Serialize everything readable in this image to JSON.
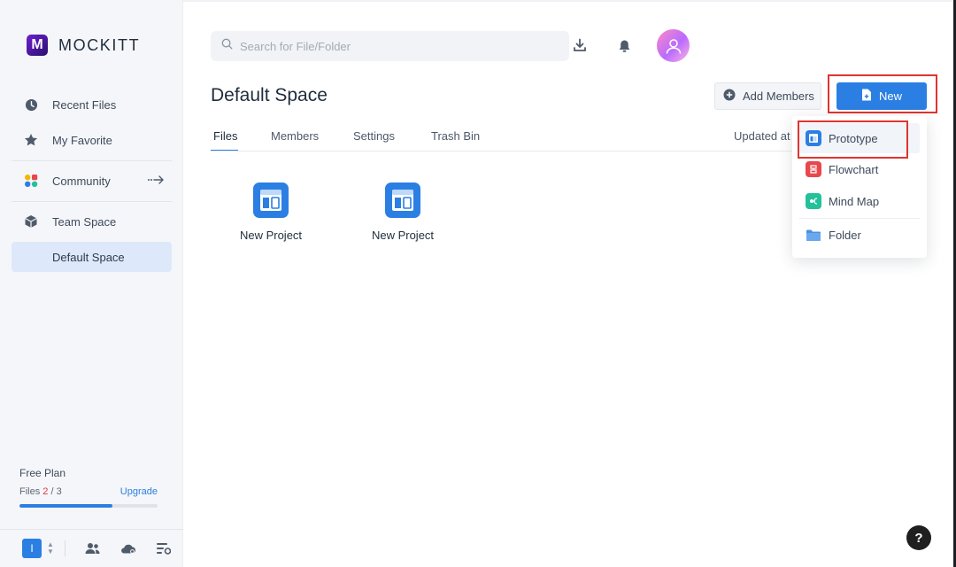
{
  "app": {
    "logo_letter": "M",
    "name": "MOCKITT"
  },
  "sidebar": {
    "items": [
      {
        "label": "Recent Files",
        "icon": "clock-icon"
      },
      {
        "label": "My Favorite",
        "icon": "star-icon"
      },
      {
        "label": "Community",
        "icon": "community-icon",
        "arrow": "···→"
      },
      {
        "label": "Team Space",
        "icon": "cube-icon"
      },
      {
        "label": "Default Space",
        "active": true
      }
    ],
    "plan": {
      "title": "Free Plan",
      "files_label": "Files",
      "files_used": "2",
      "files_separator": " / ",
      "files_total": "3",
      "upgrade": "Upgrade",
      "usage_fraction": 0.67
    },
    "bottom": {
      "team_initial": "I",
      "updown": "▲▼"
    }
  },
  "header": {
    "search_placeholder": "Search for File/Folder"
  },
  "main": {
    "title": "Default Space",
    "add_members": "Add Members",
    "new_button": "New",
    "tabs": [
      "Files",
      "Members",
      "Settings",
      "Trash Bin"
    ],
    "updated_at": "Updated at",
    "projects": [
      {
        "label": "New Project"
      },
      {
        "label": "New Project"
      }
    ]
  },
  "new_menu": {
    "items": [
      {
        "label": "Prototype",
        "color": "#2b7fe3"
      },
      {
        "label": "Flowchart",
        "color": "#e8474c"
      },
      {
        "label": "Mind Map",
        "color": "#23c19a"
      },
      {
        "label": "Folder",
        "color": "#4a90e2"
      }
    ]
  },
  "help": {
    "label": "?"
  },
  "colors": {
    "accent": "#2b7fe3",
    "highlight": "#e0342f"
  }
}
